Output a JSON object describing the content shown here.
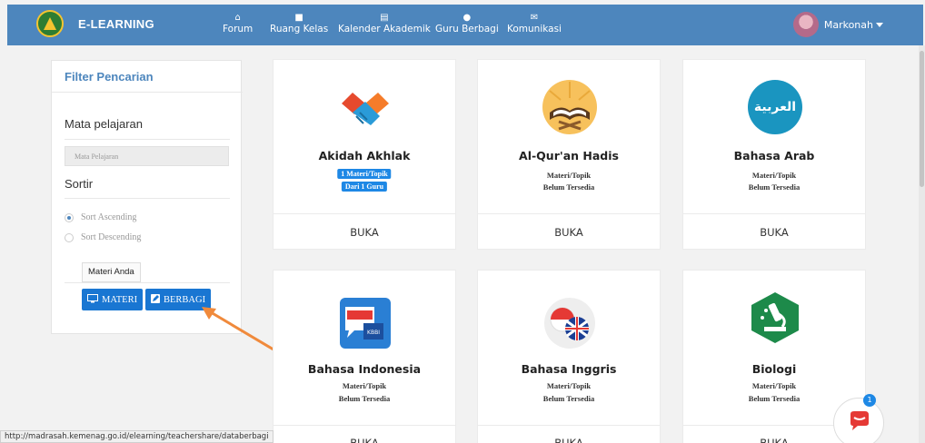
{
  "navbar": {
    "brand": "E-LEARNING",
    "items": [
      {
        "label": "Forum",
        "icon": "home-icon"
      },
      {
        "label": "Ruang Kelas",
        "icon": "classroom-icon"
      },
      {
        "label": "Kalender Akademik",
        "icon": "calendar-icon"
      },
      {
        "label": "Guru Berbagi",
        "icon": "user-icon"
      },
      {
        "label": "Komunikasi",
        "icon": "envelope-icon"
      }
    ],
    "user_name": "Markonah"
  },
  "filter": {
    "title": "Filter Pencarian",
    "subject_label": "Mata pelajaran",
    "subject_placeholder": "Mata Pelajaran",
    "sort_label": "Sortir",
    "sort_options": [
      "Sort Ascending",
      "Sort Descending"
    ],
    "sort_selected": "Sort Ascending",
    "tab_label": "Materi Anda",
    "materi_button": "MATERI",
    "berbagi_button": "BERBAGI"
  },
  "cards": [
    {
      "title": "Akidah Akhlak",
      "line1": "1 Materi/Topik",
      "line2": "Dari 1 Guru",
      "badges": true,
      "button": "BUKA"
    },
    {
      "title": "Al-Qur'an Hadis",
      "line1": "Materi/Topik",
      "line2": "Belum Tersedia",
      "badges": false,
      "button": "BUKA"
    },
    {
      "title": "Bahasa Arab",
      "line1": "Materi/Topik",
      "line2": "Belum Tersedia",
      "badges": false,
      "button": "BUKA",
      "icon_text": "العربية"
    },
    {
      "title": "Bahasa Indonesia",
      "line1": "Materi/Topik",
      "line2": "Belum Tersedia",
      "badges": false,
      "button": "BUKA"
    },
    {
      "title": "Bahasa Inggris",
      "line1": "Materi/Topik",
      "line2": "Belum Tersedia",
      "badges": false,
      "button": "BUKA"
    },
    {
      "title": "Biologi",
      "line1": "Materi/Topik",
      "line2": "Belum Tersedia",
      "badges": false,
      "button": "BUKA"
    }
  ],
  "status_url": "http://madrasah.kemenag.go.id/elearning/teachershare/databerbagi",
  "chat_badge": "1",
  "colors": {
    "navbar": "#4d86bd",
    "button": "#1976d2",
    "badge": "#1e88e5",
    "annotation_arrow": "#f08a3c"
  }
}
